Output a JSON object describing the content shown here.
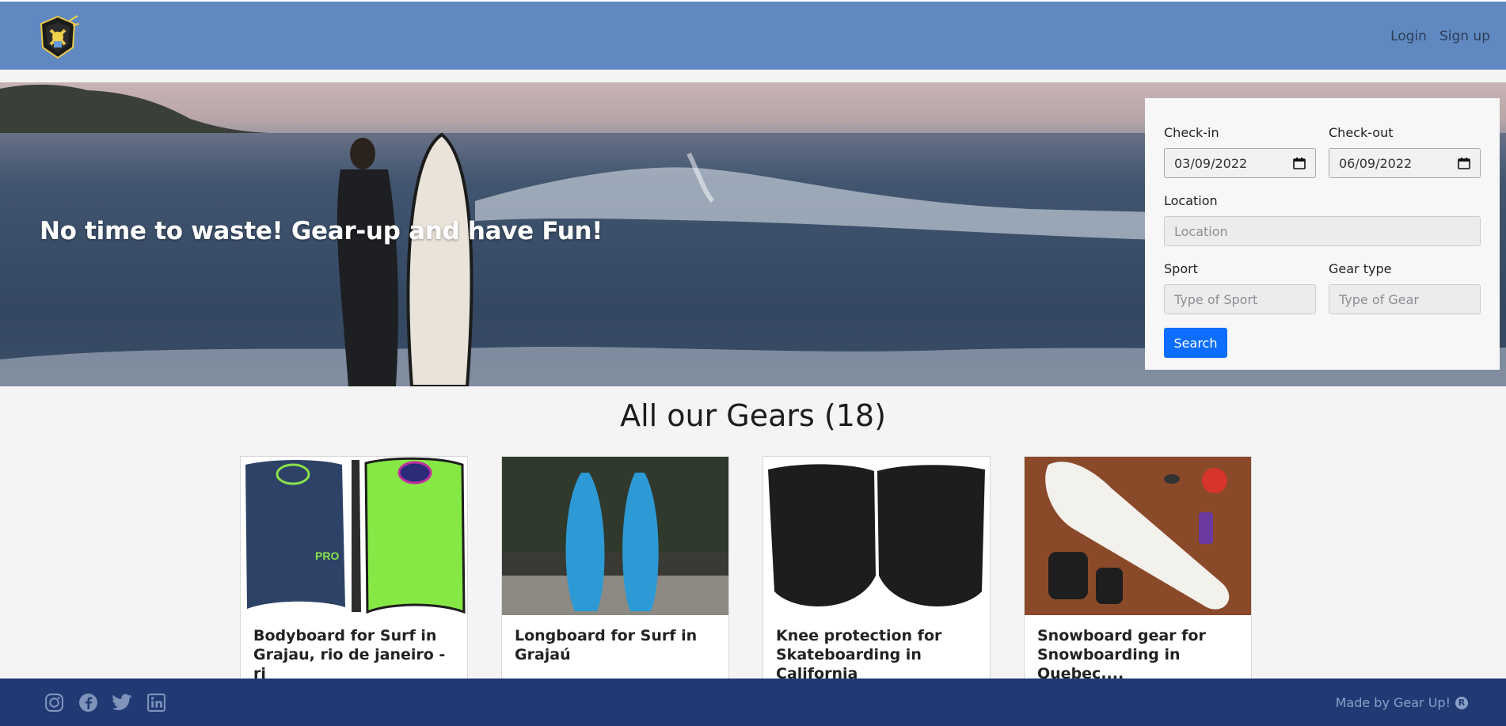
{
  "nav": {
    "logo_icon": "gear-up-shield-logo",
    "login_label": "Login",
    "signup_label": "Sign up"
  },
  "hero": {
    "title": "No time to waste! Gear-up and have Fun!"
  },
  "search": {
    "checkin_label": "Check-in",
    "checkin_value": "03/09/2022",
    "checkout_label": "Check-out",
    "checkout_value": "06/09/2022",
    "location_label": "Location",
    "location_placeholder": "Location",
    "sport_label": "Sport",
    "sport_placeholder": "Type of Sport",
    "gear_label": "Gear type",
    "gear_placeholder": "Type of Gear",
    "button_label": "Search"
  },
  "gears": {
    "title": "All our Gears (18)",
    "cards": [
      {
        "title": "Bodyboard for Surf in Grajau, rio de janeiro -rj",
        "image": "bodyboard-image"
      },
      {
        "title": "Longboard for Surf in Grajaú",
        "image": "longboard-image"
      },
      {
        "title": "Knee protection for Skateboarding in California",
        "image": "knee-pads-image"
      },
      {
        "title": "Snowboard gear for Snowboarding in Quebec,...",
        "image": "snowboard-image"
      }
    ]
  },
  "footer": {
    "icons": [
      "instagram-icon",
      "facebook-icon",
      "twitter-icon",
      "linkedin-icon"
    ],
    "made_by": "Made by Gear Up!",
    "reg_mark": "R"
  },
  "colors": {
    "navbar": "#6089c1",
    "footer": "#213a74",
    "primary_button": "#0d6efd"
  }
}
